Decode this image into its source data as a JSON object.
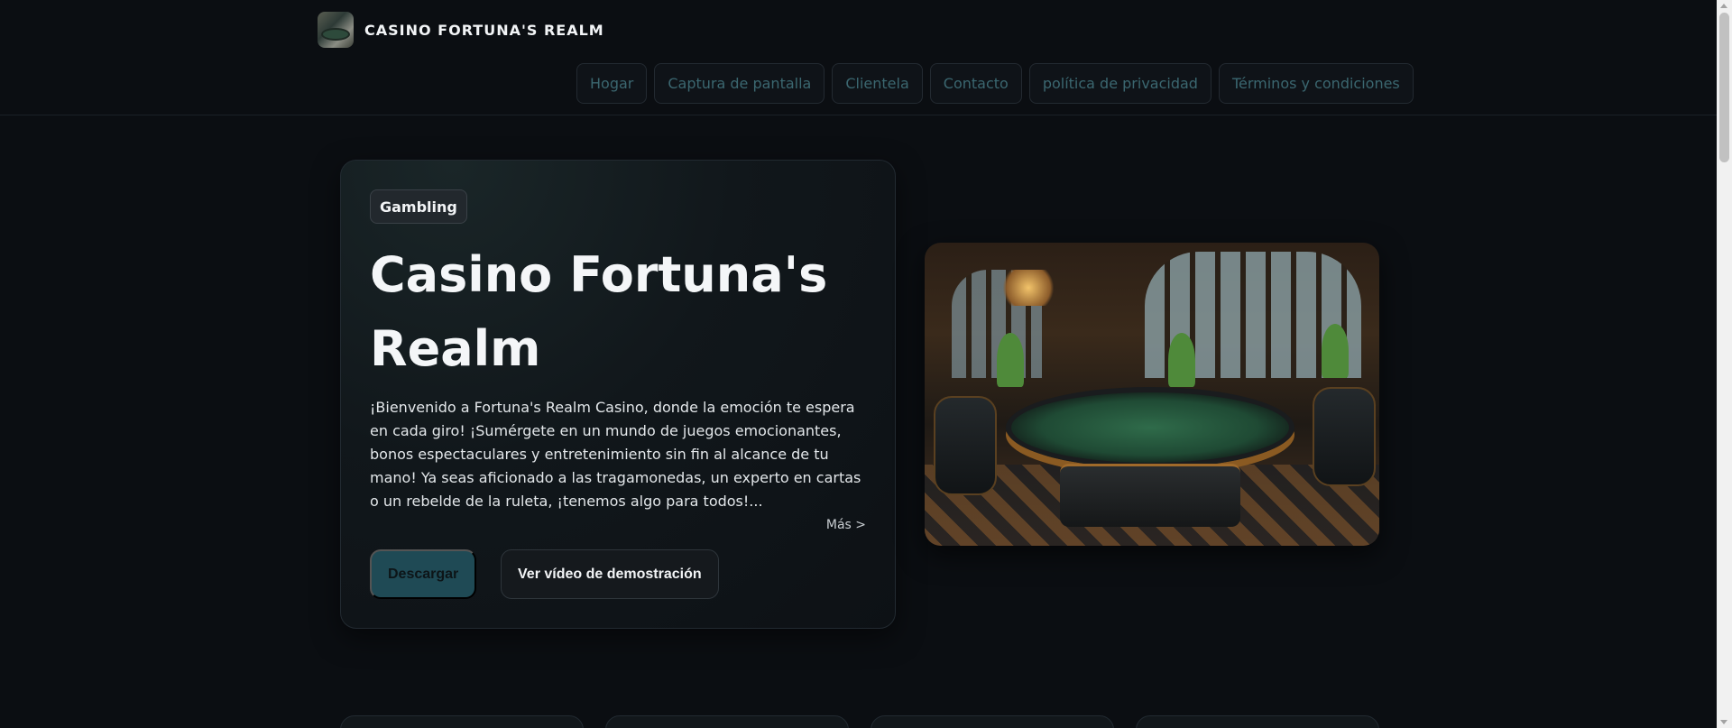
{
  "header": {
    "brand_name": "CASINO FORTUNA'S REALM",
    "logo_icon": "casino-room-logo-icon",
    "nav": [
      {
        "label": "Hogar"
      },
      {
        "label": "Captura de pantalla"
      },
      {
        "label": "Clientela"
      },
      {
        "label": "Contacto"
      },
      {
        "label": "política de privacidad"
      },
      {
        "label": "Términos y condiciones"
      }
    ]
  },
  "hero": {
    "tag": "Gambling",
    "title": "Casino Fortuna's Realm",
    "description": "¡Bienvenido a Fortuna's Realm Casino, donde la emoción te espera en cada giro! ¡Sumérgete en un mundo de juegos emocionantes, bonos espectaculares y entretenimiento sin fin al alcance de tu mano! Ya seas aficionado a las tragamonedas, un experto en cartas o un rebelde de la ruleta, ¡tenemos algo para todos!...",
    "more_link": "Más >",
    "primary_button": "Descargar",
    "secondary_button": "Ver vídeo de demostración",
    "image_subject": "luxury-casino-poker-room-image"
  },
  "colors": {
    "background": "#0b0e12",
    "nav_text": "#3b6770",
    "primary_button_bg": "#1f4a55"
  }
}
